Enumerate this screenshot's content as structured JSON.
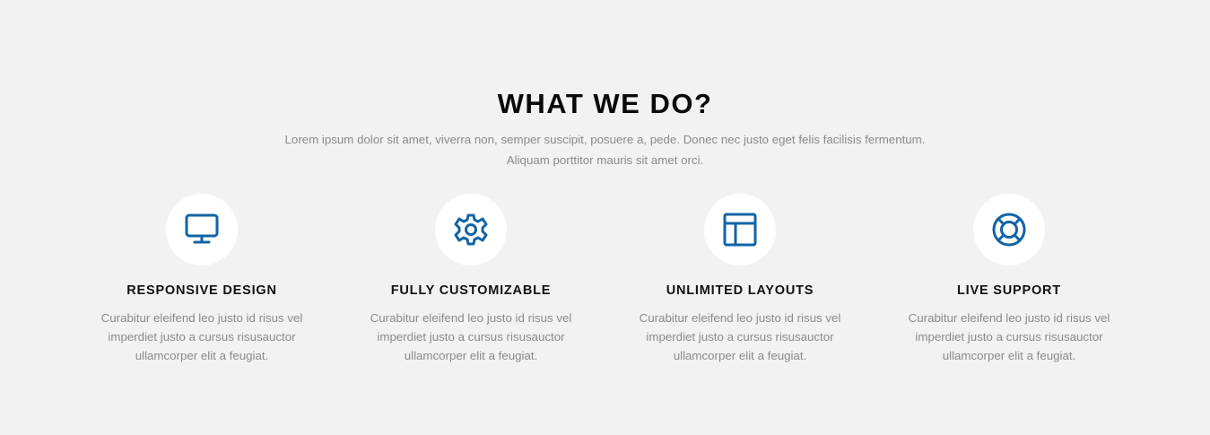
{
  "theme": {
    "background": "#f2f2f2",
    "accent": "#1164a6",
    "circle_background": "#ffffff",
    "text_muted": "#8a8a8a"
  },
  "section": {
    "title": "WHAT WE DO?",
    "subtitle_line1": "Lorem ipsum dolor sit amet, viverra non, semper suscipit, posuere a, pede. Donec nec justo eget felis facilisis fermentum.",
    "subtitle_line2": "Aliquam porttitor mauris sit amet orci."
  },
  "features": [
    {
      "icon": "monitor-icon",
      "title": "RESPONSIVE DESIGN",
      "text_line1": "Curabitur eleifend leo justo id risus vel",
      "text_line2": "imperdiet justo a cursus risusauctor",
      "text_line3": "ullamcorper elit a feugiat."
    },
    {
      "icon": "gear-icon",
      "title": "FULLY CUSTOMIZABLE",
      "text_line1": "Curabitur eleifend leo justo id risus vel",
      "text_line2": "imperdiet justo a cursus risusauctor",
      "text_line3": "ullamcorper elit a feugiat."
    },
    {
      "icon": "layout-icon",
      "title": "UNLIMITED LAYOUTS",
      "text_line1": "Curabitur eleifend leo justo id risus vel",
      "text_line2": "imperdiet justo a cursus risusauctor",
      "text_line3": "ullamcorper elit a feugiat."
    },
    {
      "icon": "lifebuoy-icon",
      "title": "LIVE SUPPORT",
      "text_line1": "Curabitur eleifend leo justo id risus vel",
      "text_line2": "imperdiet justo a cursus risusauctor",
      "text_line3": "ullamcorper elit a feugiat."
    }
  ]
}
